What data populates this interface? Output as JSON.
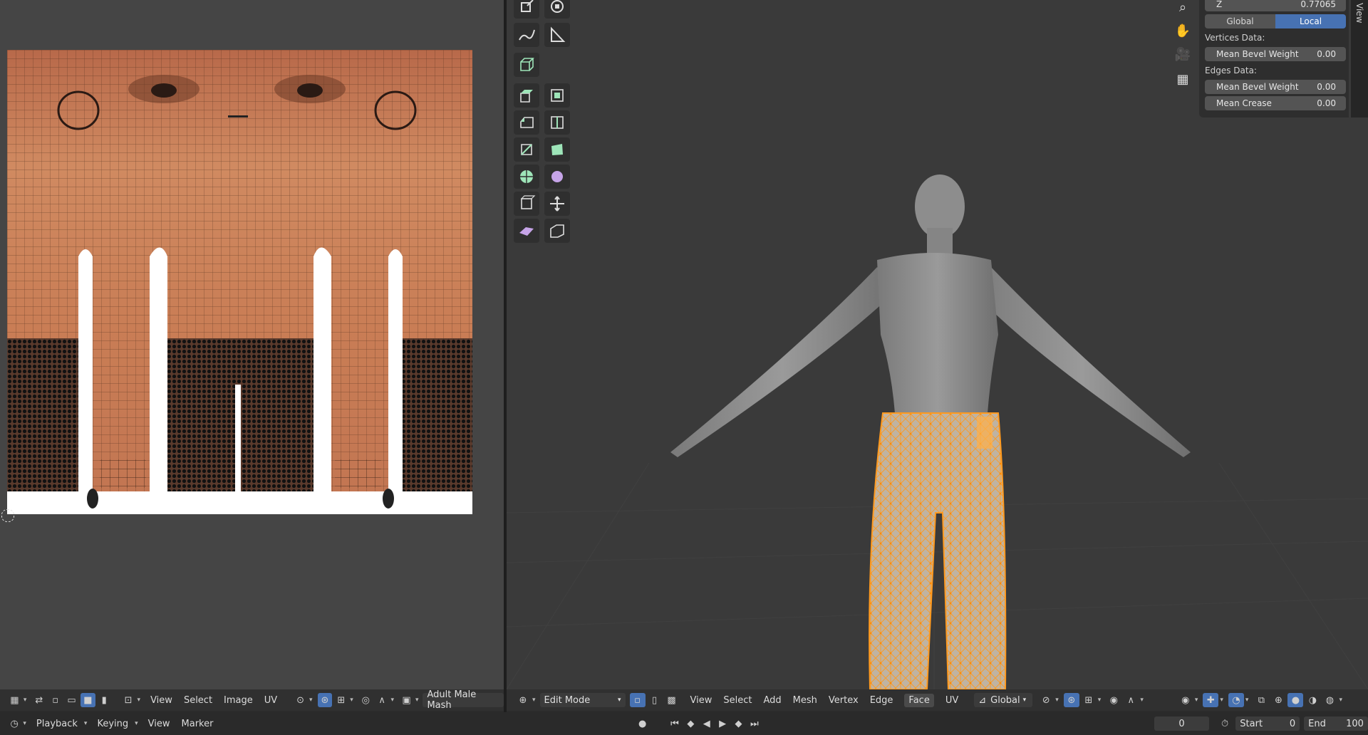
{
  "uv_editor": {
    "header": {
      "menus": [
        "View",
        "Select",
        "Image",
        "UV"
      ],
      "image_name": "Adult Male Mash"
    }
  },
  "viewport": {
    "header": {
      "mode": "Edit Mode",
      "menus": [
        "View",
        "Select",
        "Add",
        "Mesh",
        "Vertex",
        "Edge",
        "Face",
        "UV"
      ],
      "transform_orientation": "Global"
    }
  },
  "n_panel": {
    "z_label": "Z",
    "z_value": "0.77065",
    "global_label": "Global",
    "local_label": "Local",
    "vertices_header": "Vertices Data:",
    "vertex_bevel_label": "Mean Bevel Weight",
    "vertex_bevel_value": "0.00",
    "edges_header": "Edges Data:",
    "edge_bevel_label": "Mean Bevel Weight",
    "edge_bevel_value": "0.00",
    "crease_label": "Mean Crease",
    "crease_value": "0.00",
    "side_tab": "View"
  },
  "timeline": {
    "menus": [
      "Playback",
      "Keying",
      "View",
      "Marker"
    ],
    "current_frame": "0",
    "start_label": "Start",
    "start_value": "0",
    "end_label": "End",
    "end_value": "100"
  },
  "colors": {
    "accent_blue": "#4772b3",
    "selection_orange": "#ff9a1f",
    "skin": "#c57a52"
  }
}
